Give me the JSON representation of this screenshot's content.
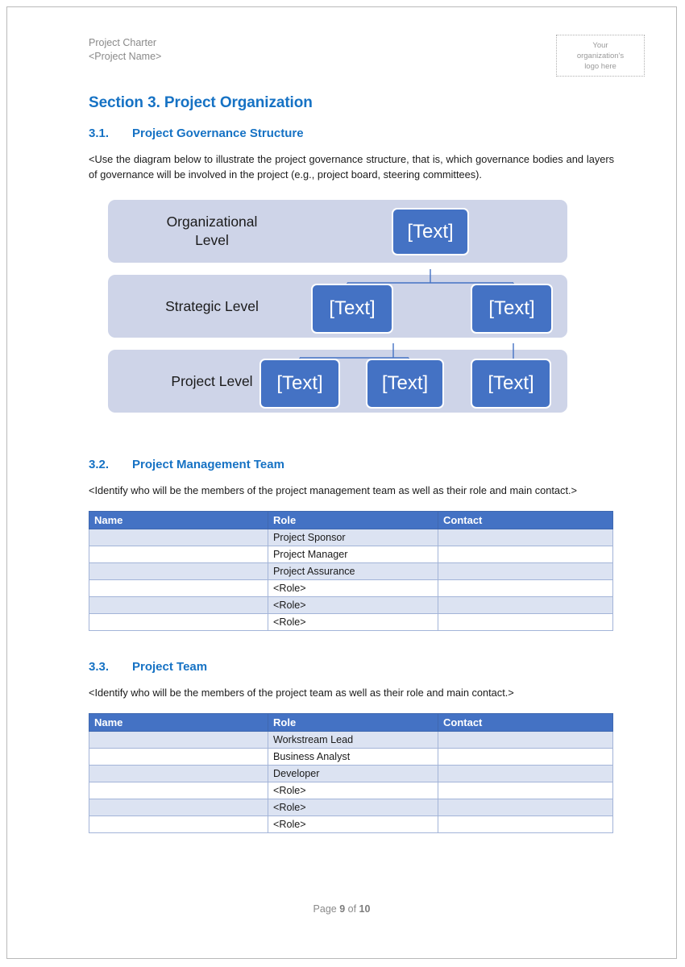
{
  "header": {
    "line1": "Project Charter",
    "line2": "<Project Name>",
    "logo_placeholder_line1": "Your",
    "logo_placeholder_line2": "organization's",
    "logo_placeholder_line3": "logo here"
  },
  "section": {
    "title": "Section 3. Project Organization"
  },
  "subsections": [
    {
      "number": "3.1.",
      "title": "Project Governance Structure",
      "body": "<Use the diagram below to illustrate the project governance structure, that is, which governance bodies and layers of governance will be involved in the project (e.g., project board, steering committees)."
    },
    {
      "number": "3.2.",
      "title": "Project Management Team",
      "body": "<Identify who will be the members of the project management team as well as their role and main contact.>"
    },
    {
      "number": "3.3.",
      "title": "Project Team",
      "body": "<Identify who will be the members of the project team as well as their role and main contact.>"
    }
  ],
  "diagram": {
    "node_label": "[Text]",
    "band_color": "#ced4e8",
    "node_color": "#4472c4",
    "connector_color": "#4472c4",
    "levels": [
      {
        "label": "Organizational\nLevel",
        "label_line1": "Organizational",
        "label_line2": "Level",
        "node_count": 1
      },
      {
        "label": "Strategic Level",
        "label_line1": "Strategic Level",
        "label_line2": "",
        "node_count": 2
      },
      {
        "label": "Project Level",
        "label_line1": "Project Level",
        "label_line2": "",
        "node_count": 3
      }
    ]
  },
  "tables": {
    "columns": [
      "Name",
      "Role",
      "Contact"
    ],
    "management_team": {
      "rows": [
        {
          "name": "",
          "role": "Project Sponsor",
          "contact": ""
        },
        {
          "name": "",
          "role": "Project Manager",
          "contact": ""
        },
        {
          "name": "",
          "role": "Project Assurance",
          "contact": ""
        },
        {
          "name": "",
          "role": "<Role>",
          "contact": ""
        },
        {
          "name": "",
          "role": "<Role>",
          "contact": ""
        },
        {
          "name": "",
          "role": "<Role>",
          "contact": ""
        }
      ]
    },
    "project_team": {
      "rows": [
        {
          "name": "",
          "role": "Workstream Lead",
          "contact": ""
        },
        {
          "name": "",
          "role": "Business Analyst",
          "contact": ""
        },
        {
          "name": "",
          "role": "Developer",
          "contact": ""
        },
        {
          "name": "",
          "role": "<Role>",
          "contact": ""
        },
        {
          "name": "",
          "role": "<Role>",
          "contact": ""
        },
        {
          "name": "",
          "role": "<Role>",
          "contact": ""
        }
      ]
    }
  },
  "footer": {
    "prefix": "Page ",
    "current_page": "9",
    "middle": " of ",
    "total_pages": "10"
  },
  "colors": {
    "heading_blue": "#1672c4",
    "table_header_blue": "#4472c4",
    "table_alt_row": "#dce3f2",
    "band_lavender": "#ced4e8"
  }
}
